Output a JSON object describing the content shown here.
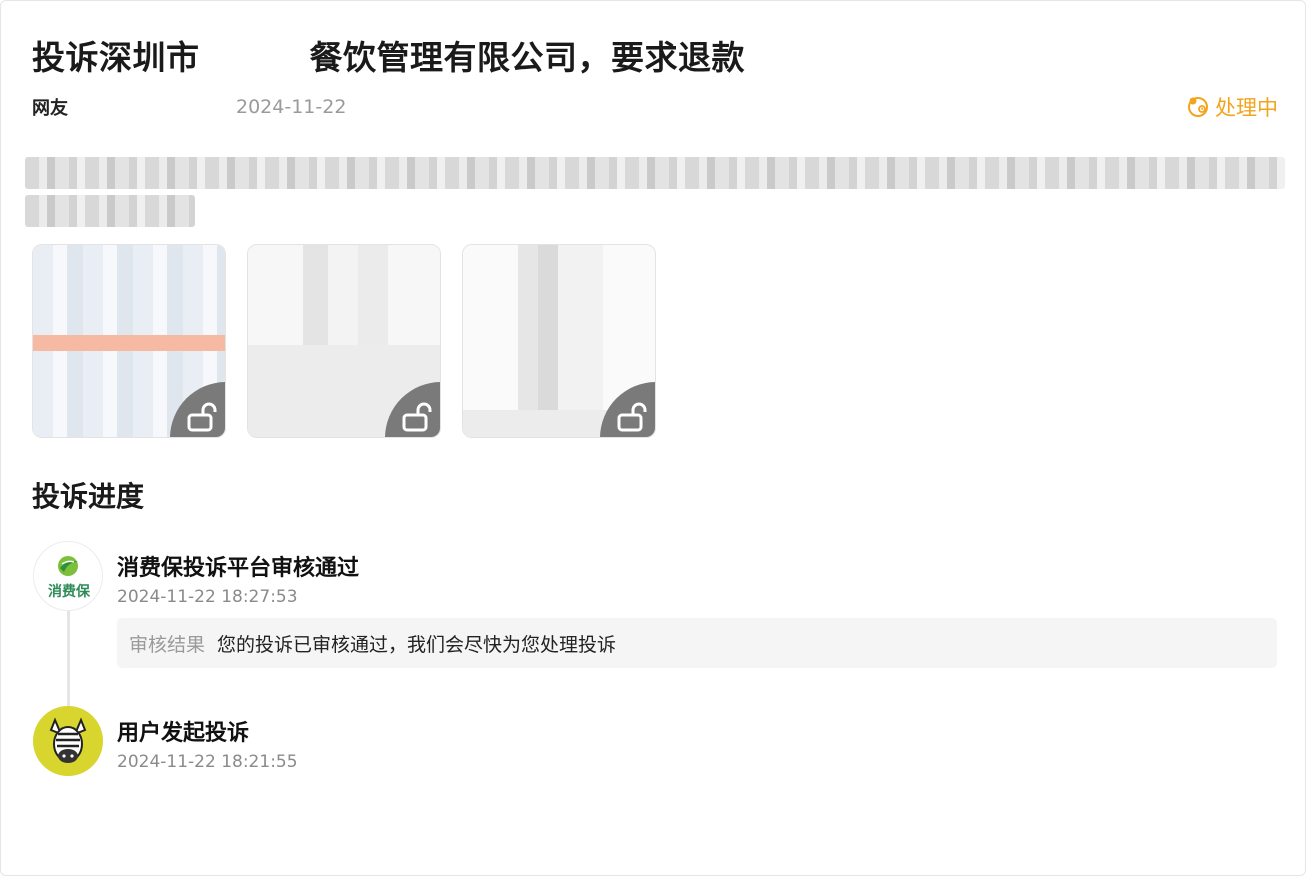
{
  "complaint": {
    "title_part1": "投诉深圳市",
    "title_part2": "餐饮管理有限公司，要求退款",
    "author": "网友",
    "date": "2024-11-22",
    "status": "处理中",
    "status_color": "#f2a41c",
    "status_icon": "processing-icon"
  },
  "attachments": {
    "count": 3,
    "lock_icon": "unlock-icon"
  },
  "progress": {
    "section_title": "投诉进度",
    "events": [
      {
        "avatar_text": "消费保",
        "title": "消费保投诉平台审核通过",
        "time": "2024-11-22 18:27:53",
        "result_label": "审核结果",
        "result_text": "您的投诉已审核通过，我们会尽快为您处理投诉"
      },
      {
        "avatar_icon": "zebra-avatar-icon",
        "title": "用户发起投诉",
        "time": "2024-11-22 18:21:55"
      }
    ]
  }
}
